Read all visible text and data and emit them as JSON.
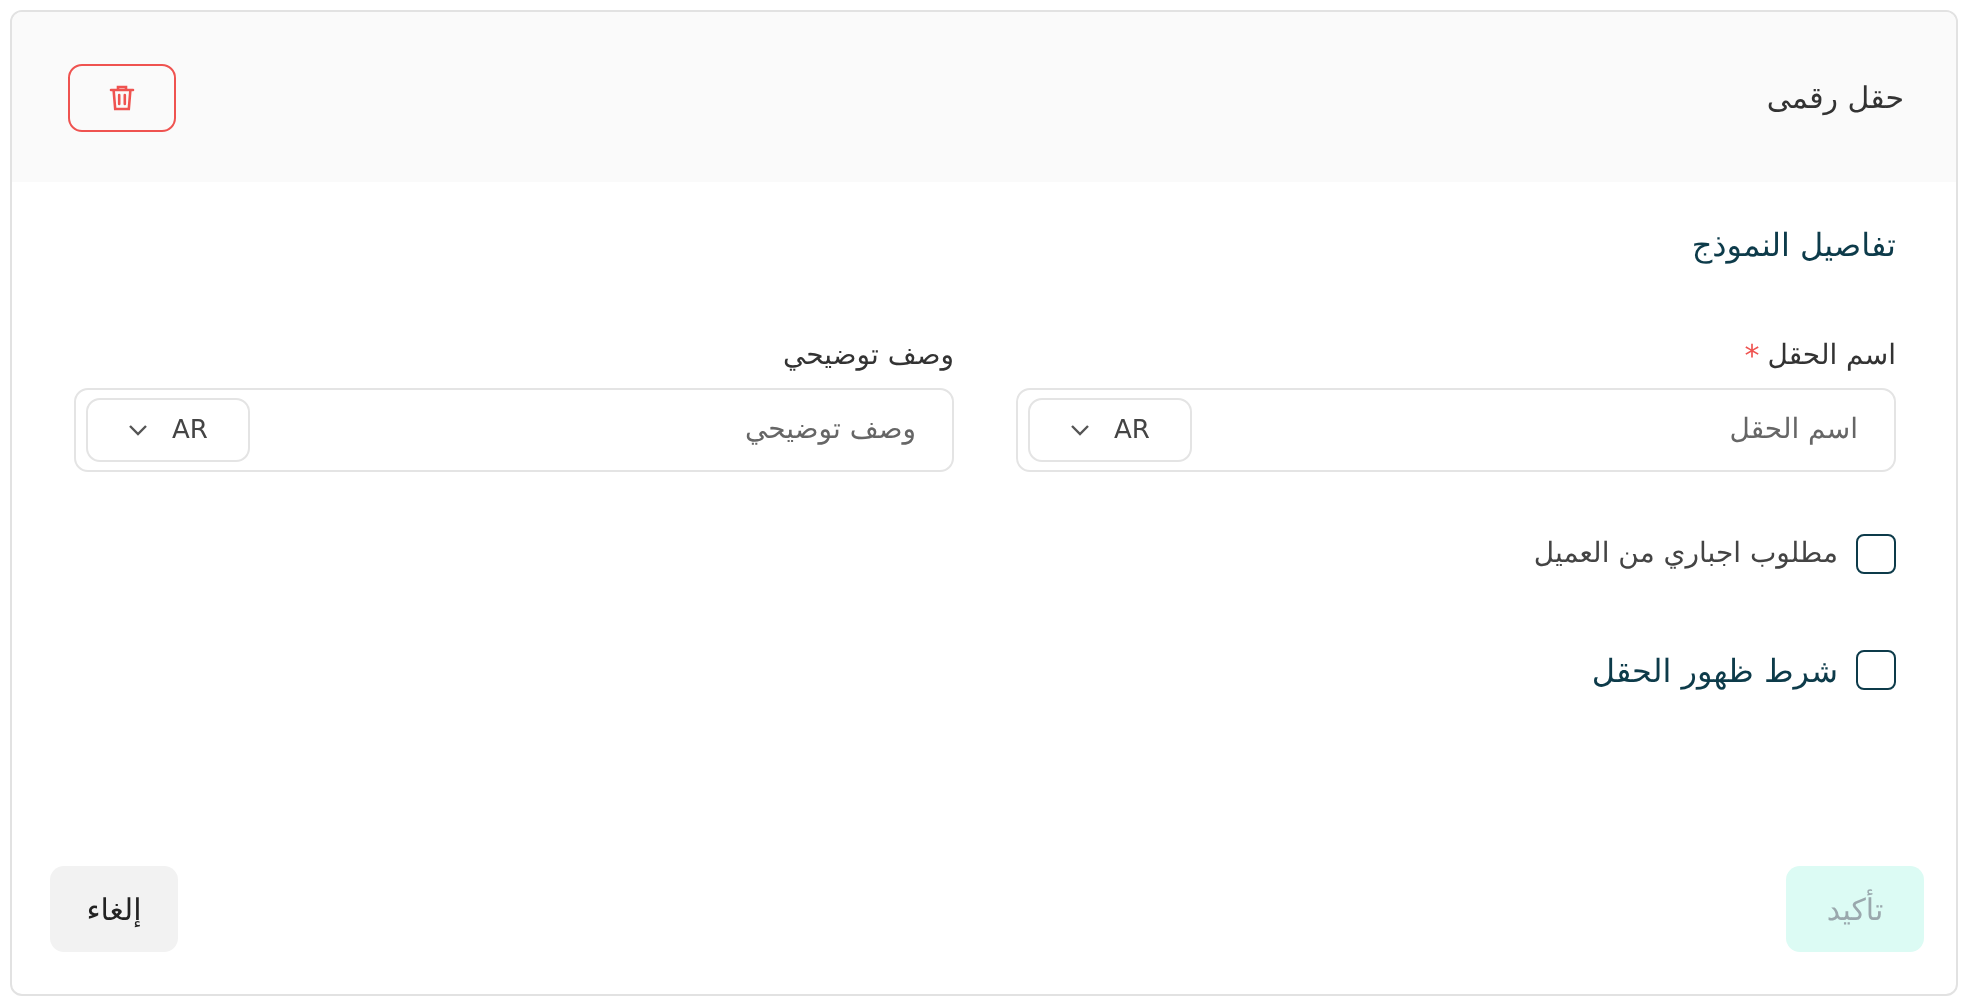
{
  "header": {
    "title": "حقل رقمى",
    "delete_button": {
      "kind": "delete"
    }
  },
  "section_title": "تفاصيل النموذج",
  "fields": [
    {
      "label": "اسم الحقل",
      "required_mark": "*",
      "placeholder": "اسم الحقل",
      "language": "AR"
    },
    {
      "label": "وصف توضيحي",
      "placeholder": "وصف توضيحي",
      "language": "AR"
    }
  ],
  "checkboxes": [
    {
      "label": "مطلوب اجباري من العميل",
      "checked": false,
      "kind": "plain"
    },
    {
      "label": "شرط ظهور الحقل",
      "checked": false,
      "kind": "heading"
    }
  ],
  "footer": {
    "confirm": {
      "label": "تأكيد",
      "disabled": true
    },
    "cancel": {
      "label": "إلغاء"
    }
  }
}
